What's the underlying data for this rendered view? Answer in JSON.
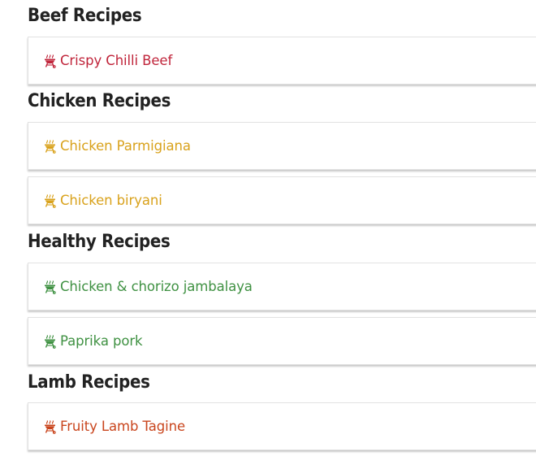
{
  "sections": [
    {
      "title": "Beef Recipes",
      "color": "#c0253b",
      "recipes": [
        {
          "name": "Crispy Chilli Beef",
          "icon": "bbq-grill-icon"
        }
      ]
    },
    {
      "title": "Chicken Recipes",
      "color": "#d9a21c",
      "recipes": [
        {
          "name": "Chicken Parmigiana",
          "icon": "bbq-grill-icon"
        },
        {
          "name": "Chicken biryani",
          "icon": "bbq-grill-icon"
        }
      ]
    },
    {
      "title": "Healthy Recipes",
      "color": "#3f9142",
      "recipes": [
        {
          "name": "Chicken & chorizo jambalaya",
          "icon": "bbq-grill-icon"
        },
        {
          "name": "Paprika pork",
          "icon": "bbq-grill-icon"
        }
      ]
    },
    {
      "title": "Lamb Recipes",
      "color": "#c9451d",
      "recipes": [
        {
          "name": "Fruity Lamb Tagine",
          "icon": "bbq-grill-icon"
        }
      ]
    }
  ]
}
